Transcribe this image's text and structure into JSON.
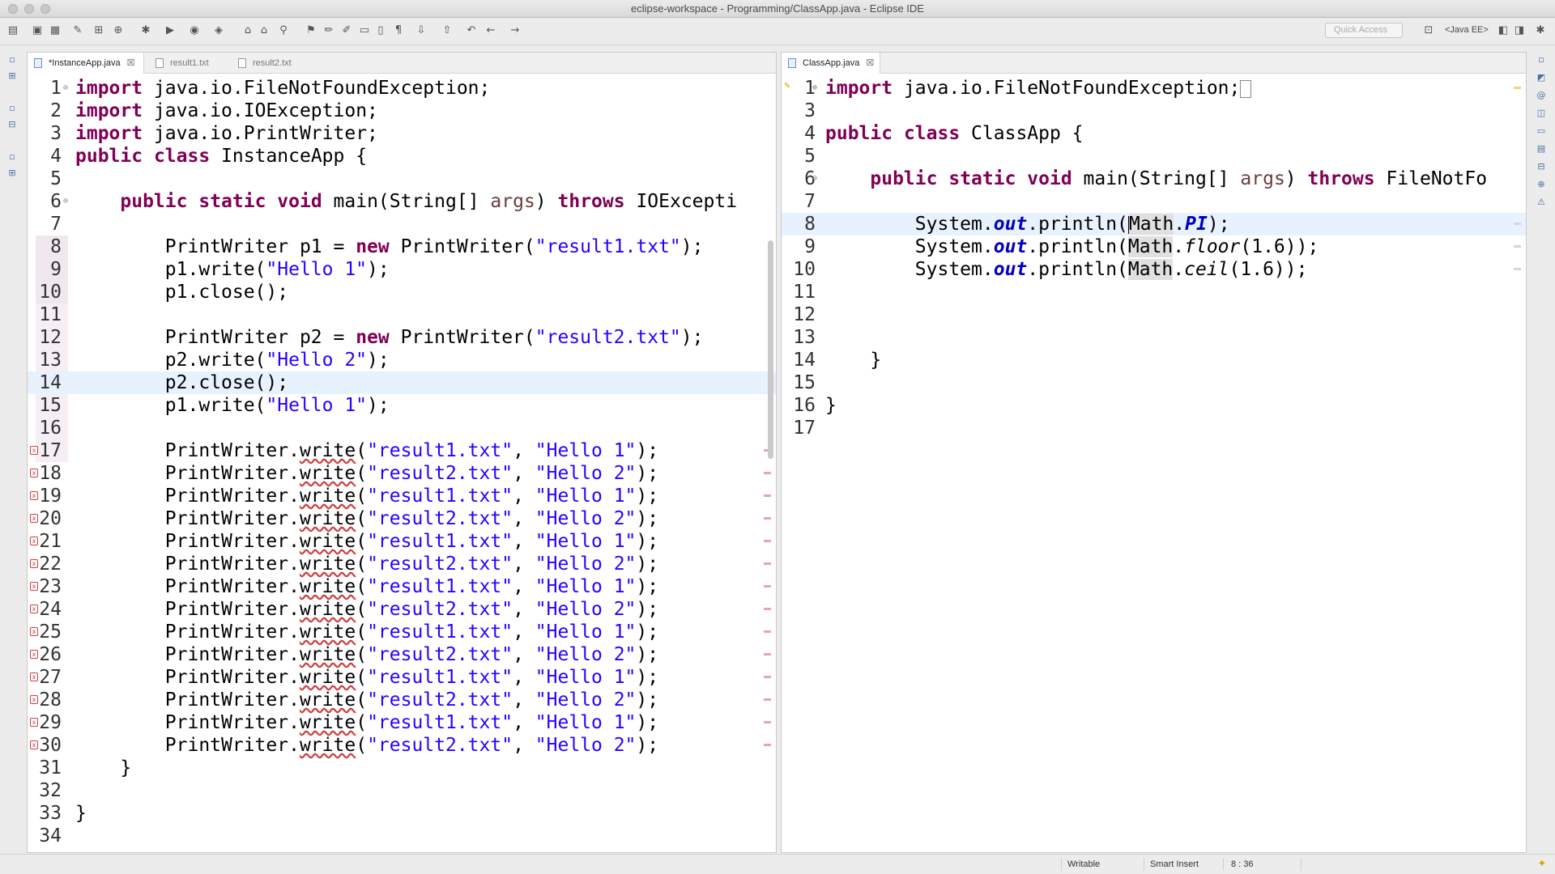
{
  "window": {
    "title": "eclipse-workspace - Programming/ClassApp.java - Eclipse IDE"
  },
  "toolbar": {
    "quick_access_placeholder": "Quick Access",
    "perspective": "<Java EE>"
  },
  "left_editor": {
    "tabs": [
      {
        "label": "*InstanceApp.java",
        "active": true,
        "close": "☒"
      },
      {
        "label": "result1.txt",
        "active": false
      },
      {
        "label": "result2.txt",
        "active": false
      }
    ],
    "lines": [
      {
        "n": "1",
        "code": "import java.io.FileNotFoundException;"
      },
      {
        "n": "2",
        "code": "import java.io.IOException;"
      },
      {
        "n": "3",
        "code": "import java.io.PrintWriter;"
      },
      {
        "n": "4",
        "code": "public class InstanceApp {"
      },
      {
        "n": "5",
        "code": ""
      },
      {
        "n": "6",
        "code": "    public static void main(String[] args) throws IOExcepti"
      },
      {
        "n": "7",
        "code": ""
      },
      {
        "n": "8",
        "code": "        PrintWriter p1 = new PrintWriter(\"result1.txt\");"
      },
      {
        "n": "9",
        "code": "        p1.write(\"Hello 1\");"
      },
      {
        "n": "10",
        "code": "        p1.close();"
      },
      {
        "n": "11",
        "code": ""
      },
      {
        "n": "12",
        "code": "        PrintWriter p2 = new PrintWriter(\"result2.txt\");"
      },
      {
        "n": "13",
        "code": "        p2.write(\"Hello 2\");"
      },
      {
        "n": "14",
        "code": "        p2.close();"
      },
      {
        "n": "15",
        "code": "        p1.write(\"Hello 1\");"
      },
      {
        "n": "16",
        "code": ""
      },
      {
        "n": "17",
        "code": "        PrintWriter.write(\"result1.txt\", \"Hello 1\");"
      },
      {
        "n": "18",
        "code": "        PrintWriter.write(\"result2.txt\", \"Hello 2\");"
      },
      {
        "n": "19",
        "code": "        PrintWriter.write(\"result1.txt\", \"Hello 1\");"
      },
      {
        "n": "20",
        "code": "        PrintWriter.write(\"result2.txt\", \"Hello 2\");"
      },
      {
        "n": "21",
        "code": "        PrintWriter.write(\"result1.txt\", \"Hello 1\");"
      },
      {
        "n": "22",
        "code": "        PrintWriter.write(\"result2.txt\", \"Hello 2\");"
      },
      {
        "n": "23",
        "code": "        PrintWriter.write(\"result1.txt\", \"Hello 1\");"
      },
      {
        "n": "24",
        "code": "        PrintWriter.write(\"result2.txt\", \"Hello 2\");"
      },
      {
        "n": "25",
        "code": "        PrintWriter.write(\"result1.txt\", \"Hello 1\");"
      },
      {
        "n": "26",
        "code": "        PrintWriter.write(\"result2.txt\", \"Hello 2\");"
      },
      {
        "n": "27",
        "code": "        PrintWriter.write(\"result1.txt\", \"Hello 1\");"
      },
      {
        "n": "28",
        "code": "        PrintWriter.write(\"result2.txt\", \"Hello 2\");"
      },
      {
        "n": "29",
        "code": "        PrintWriter.write(\"result1.txt\", \"Hello 1\");"
      },
      {
        "n": "30",
        "code": "        PrintWriter.write(\"result2.txt\", \"Hello 2\");"
      },
      {
        "n": "31",
        "code": "    }"
      },
      {
        "n": "32",
        "code": ""
      },
      {
        "n": "33",
        "code": "}"
      },
      {
        "n": "34",
        "code": ""
      }
    ],
    "highlighted_line": "14",
    "error_lines": [
      "17",
      "18",
      "19",
      "20",
      "21",
      "22",
      "23",
      "24",
      "25",
      "26",
      "27",
      "28",
      "29",
      "30"
    ]
  },
  "right_editor": {
    "tabs": [
      {
        "label": "ClassApp.java",
        "active": true,
        "close": "☒"
      }
    ],
    "lines": [
      {
        "n": "1",
        "code": "import java.io.FileNotFoundException;"
      },
      {
        "n": "3",
        "code": ""
      },
      {
        "n": "4",
        "code": "public class ClassApp {"
      },
      {
        "n": "5",
        "code": ""
      },
      {
        "n": "6",
        "code": "    public static void main(String[] args) throws FileNotFo"
      },
      {
        "n": "7",
        "code": ""
      },
      {
        "n": "8",
        "code": "        System.out.println(Math.PI);"
      },
      {
        "n": "9",
        "code": "        System.out.println(Math.floor(1.6));"
      },
      {
        "n": "10",
        "code": "        System.out.println(Math.ceil(1.6));"
      },
      {
        "n": "11",
        "code": ""
      },
      {
        "n": "12",
        "code": ""
      },
      {
        "n": "13",
        "code": ""
      },
      {
        "n": "14",
        "code": "    }"
      },
      {
        "n": "15",
        "code": ""
      },
      {
        "n": "16",
        "code": "}"
      },
      {
        "n": "17",
        "code": ""
      }
    ],
    "highlighted_line": "8"
  },
  "statusbar": {
    "mode": "Writable",
    "insert": "Smart Insert",
    "position": "8 : 36"
  },
  "colors": {
    "keyword": "#7f0055",
    "string": "#2a00ff",
    "static_field": "#0000c0",
    "current_line": "#e8f2fe",
    "error_marker": "#d04040"
  }
}
